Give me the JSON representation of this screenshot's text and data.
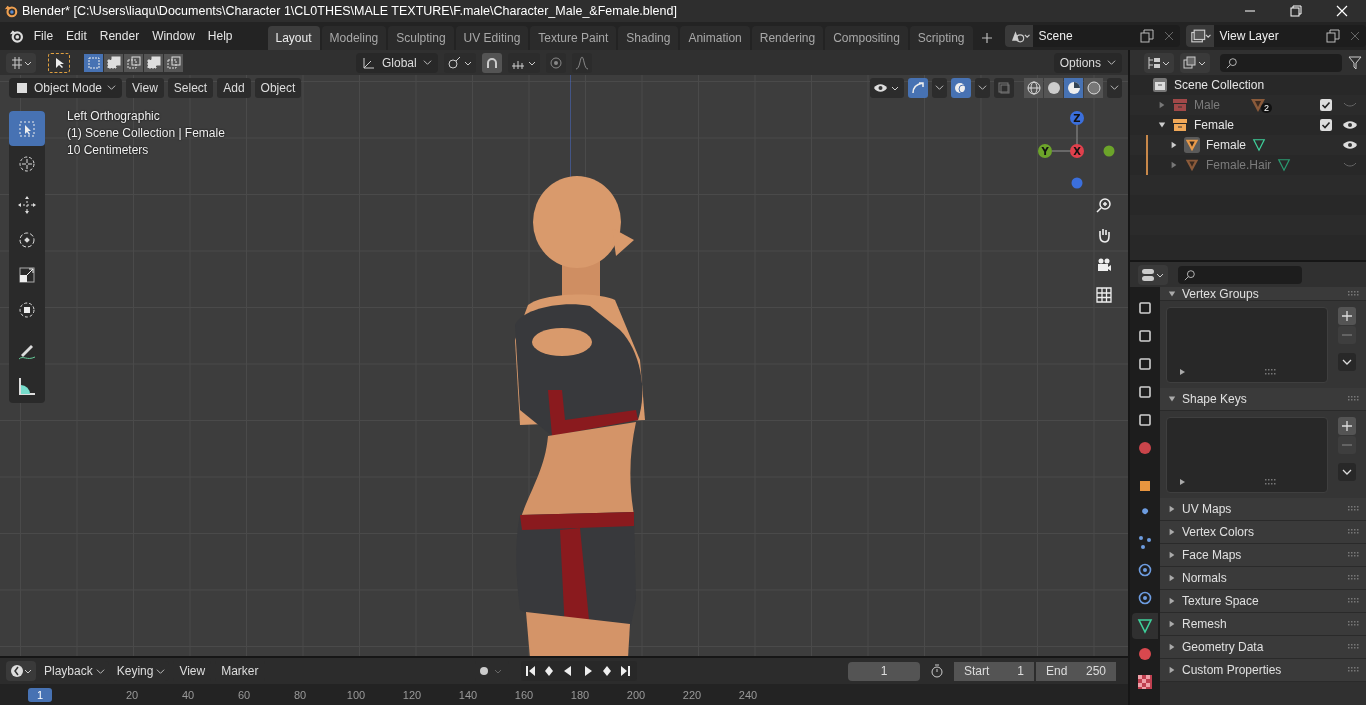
{
  "window": {
    "title": "Blender* [C:\\Users\\liaqu\\Documents\\Character 1\\CL0THES\\MALE TEXTURE\\F.male\\Character_Male_&Female.blend]"
  },
  "menu": [
    "File",
    "Edit",
    "Render",
    "Window",
    "Help"
  ],
  "workspaces": [
    {
      "label": "Layout",
      "selected": true
    },
    {
      "label": "Modeling",
      "selected": false
    },
    {
      "label": "Sculpting",
      "selected": false
    },
    {
      "label": "UV Editing",
      "selected": false
    },
    {
      "label": "Texture Paint",
      "selected": false
    },
    {
      "label": "Shading",
      "selected": false
    },
    {
      "label": "Animation",
      "selected": false
    },
    {
      "label": "Rendering",
      "selected": false
    },
    {
      "label": "Compositing",
      "selected": false
    },
    {
      "label": "Scripting",
      "selected": false
    }
  ],
  "scene": {
    "name": "Scene"
  },
  "view_layer": {
    "name": "View Layer"
  },
  "tool_header": {
    "orientation": "Global",
    "options": "Options",
    "select_modes": [
      {
        "kind": "set",
        "selected": true
      },
      {
        "kind": "extend",
        "selected": false
      },
      {
        "kind": "subtract",
        "selected": false
      },
      {
        "kind": "invert",
        "selected": false
      },
      {
        "kind": "intersect",
        "selected": false
      }
    ],
    "snap": true
  },
  "viewport_header": {
    "mode": "Object Mode",
    "menus": [
      "View",
      "Select",
      "Add",
      "Object"
    ],
    "gizmos": true,
    "overlays": true,
    "shading": [
      {
        "kind": "wireframe",
        "selected": false
      },
      {
        "kind": "solid",
        "selected": false
      },
      {
        "kind": "material",
        "selected": true
      },
      {
        "kind": "rendered",
        "selected": false
      }
    ]
  },
  "overlay_text": [
    "Left Orthographic",
    "(1) Scene Collection | Female",
    "10 Centimeters"
  ],
  "tools": [
    {
      "kind": "select",
      "selected": true
    },
    {
      "kind": "cursor",
      "selected": false
    },
    {
      "kind": "move",
      "selected": false
    },
    {
      "kind": "rotate",
      "selected": false
    },
    {
      "kind": "scale",
      "selected": false
    },
    {
      "kind": "transform",
      "selected": false
    },
    {
      "kind": "annotate",
      "selected": false
    },
    {
      "kind": "measure",
      "selected": false
    }
  ],
  "gizmo": {
    "z": "Z",
    "y": "Y",
    "x": "X"
  },
  "outliner": {
    "root": "Scene Collection",
    "items": [
      {
        "label": "Male",
        "checked": true,
        "visible": false,
        "expanded": false,
        "badge": "2"
      },
      {
        "label": "Female",
        "checked": true,
        "visible": true,
        "expanded": true,
        "children": [
          {
            "label": "Female",
            "visible": true,
            "selected": true
          },
          {
            "label": "Female.Hair",
            "visible": false,
            "selected": false
          }
        ]
      }
    ]
  },
  "properties": {
    "tabs": [
      {
        "kind": "tool",
        "selected": false
      },
      {
        "kind": "render",
        "selected": false
      },
      {
        "kind": "output",
        "selected": false
      },
      {
        "kind": "view_layer",
        "selected": false
      },
      {
        "kind": "scene",
        "selected": false
      },
      {
        "kind": "world",
        "selected": false
      },
      {
        "kind": "object",
        "selected": false
      },
      {
        "kind": "modifiers",
        "selected": false
      },
      {
        "kind": "particles",
        "selected": false
      },
      {
        "kind": "physics",
        "selected": false
      },
      {
        "kind": "constraints",
        "selected": false
      },
      {
        "kind": "data",
        "selected": true
      },
      {
        "kind": "material",
        "selected": false
      },
      {
        "kind": "texture",
        "selected": false
      }
    ],
    "panels": [
      {
        "label": "Vertex Groups",
        "expanded": true
      },
      {
        "label": "Shape Keys",
        "expanded": true
      },
      {
        "label": "UV Maps",
        "expanded": false
      },
      {
        "label": "Vertex Colors",
        "expanded": false
      },
      {
        "label": "Face Maps",
        "expanded": false
      },
      {
        "label": "Normals",
        "expanded": false
      },
      {
        "label": "Texture Space",
        "expanded": false
      },
      {
        "label": "Remesh",
        "expanded": false
      },
      {
        "label": "Geometry Data",
        "expanded": false
      },
      {
        "label": "Custom Properties",
        "expanded": false
      }
    ]
  },
  "timeline": {
    "menus": [
      "Playback",
      "Keying",
      "View",
      "Marker"
    ],
    "current_frame": "1",
    "start_label": "Start",
    "start": "1",
    "end_label": "End",
    "end": "250",
    "ruler": [
      {
        "label": "1",
        "selected": true
      },
      {
        "label": "20",
        "selected": false
      },
      {
        "label": "40",
        "selected": false
      },
      {
        "label": "60",
        "selected": false
      },
      {
        "label": "80",
        "selected": false
      },
      {
        "label": "100",
        "selected": false
      },
      {
        "label": "120",
        "selected": false
      },
      {
        "label": "140",
        "selected": false
      },
      {
        "label": "160",
        "selected": false
      },
      {
        "label": "180",
        "selected": false
      },
      {
        "label": "200",
        "selected": false
      },
      {
        "label": "220",
        "selected": false
      },
      {
        "label": "240",
        "selected": false
      }
    ]
  }
}
